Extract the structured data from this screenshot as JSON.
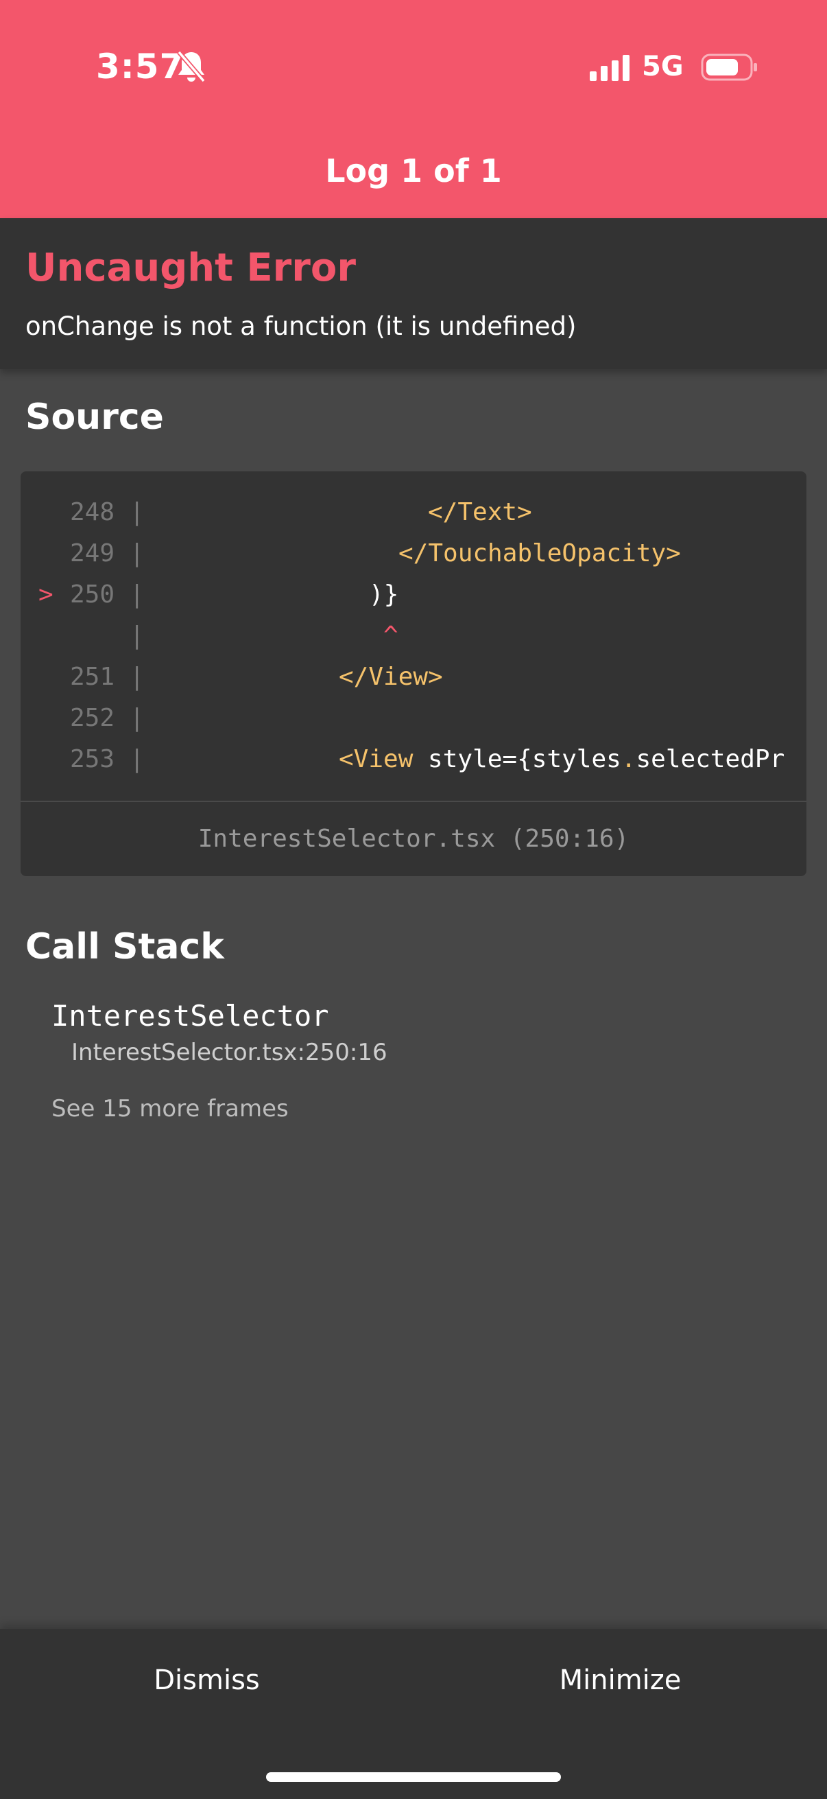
{
  "status_bar": {
    "time": "3:57",
    "network": "5G",
    "icons": [
      "bell-off-icon",
      "signal-icon",
      "battery-icon"
    ]
  },
  "header": {
    "title": "Log 1 of 1"
  },
  "error": {
    "type": "Uncaught Error",
    "message": "onChange is not a function (it is undefined)"
  },
  "source": {
    "title": "Source",
    "lines": [
      {
        "number": "248 |",
        "marker": "",
        "text": "</Text>"
      },
      {
        "number": "249 |",
        "marker": "",
        "text": "</TouchableOpacity>"
      },
      {
        "number": "250 |",
        "marker": ">",
        "text": ")}"
      },
      {
        "number": "    |",
        "marker": "",
        "text": "^"
      },
      {
        "number": "251 |",
        "marker": "",
        "text": "</View>"
      },
      {
        "number": "252 |",
        "marker": "",
        "text": ""
      },
      {
        "number": "253 |",
        "marker": "",
        "text_tag": "<View",
        "text_rest": " style={styles",
        "text_dot": ".",
        "text_tail": "selectedPr"
      }
    ],
    "file_location": "InterestSelector.tsx (250:16)"
  },
  "call_stack": {
    "title": "Call Stack",
    "frames": [
      {
        "name": "InterestSelector",
        "location": "InterestSelector.tsx:250:16"
      }
    ],
    "more_frames": "See 15 more frames"
  },
  "bottom_bar": {
    "dismiss": "Dismiss",
    "minimize": "Minimize"
  },
  "colors": {
    "accent": "#f3566b",
    "header_bg": "#f3566b",
    "panel_bg": "#333333",
    "page_bg": "#474747",
    "code_tag": "#f5c26b"
  }
}
